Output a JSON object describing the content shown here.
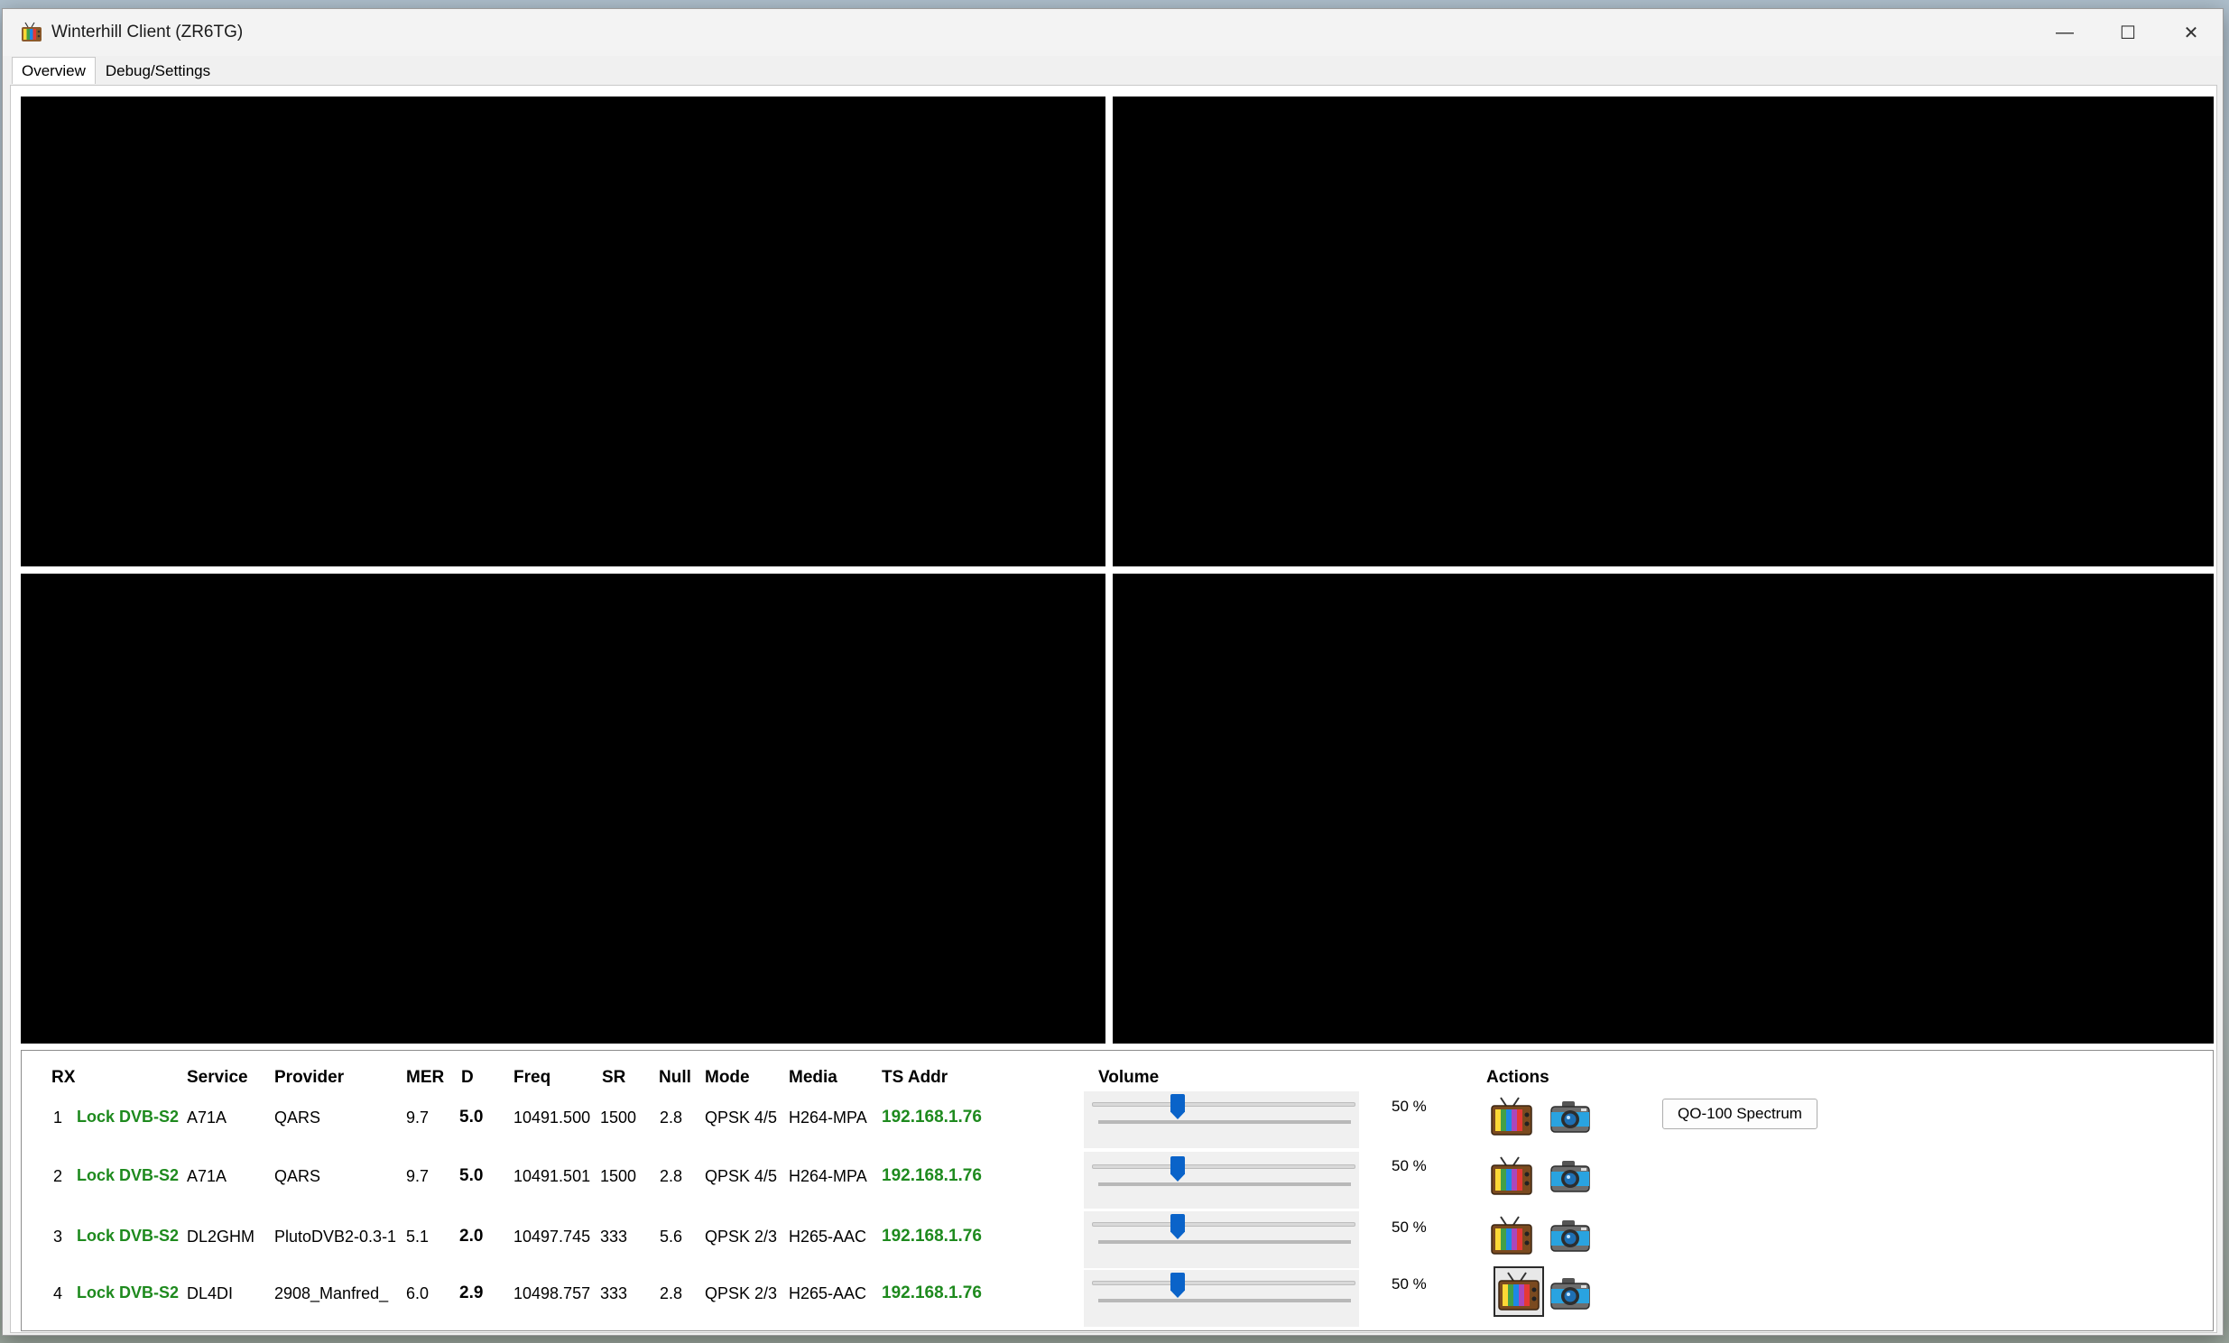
{
  "window": {
    "title": "Winterhill Client (ZR6TG)",
    "min_glyph": "—",
    "max_glyph": "☐",
    "close_glyph": "✕"
  },
  "tabs": [
    {
      "label": "Overview",
      "active": true
    },
    {
      "label": "Debug/Settings",
      "active": false
    }
  ],
  "table": {
    "headers": {
      "rx": "RX",
      "service": "Service",
      "provider": "Provider",
      "mer": "MER",
      "d": "D",
      "freq": "Freq",
      "sr": "SR",
      "null": "Null",
      "mode": "Mode",
      "media": "Media",
      "ts_addr": "TS Addr",
      "volume": "Volume",
      "actions": "Actions"
    },
    "rows": [
      {
        "rx": "1",
        "status": "Lock DVB-S2",
        "service": "A71A",
        "provider": "QARS",
        "mer": "9.7",
        "d": "5.0",
        "freq": "10491.500",
        "sr": "1500",
        "null": "2.8",
        "mode": "QPSK 4/5",
        "media": "H264-MPA",
        "ts_addr": "192.168.1.76",
        "volume_percent": 50,
        "volume_label": "50 %"
      },
      {
        "rx": "2",
        "status": "Lock DVB-S2",
        "service": "A71A",
        "provider": "QARS",
        "mer": "9.7",
        "d": "5.0",
        "freq": "10491.501",
        "sr": "1500",
        "null": "2.8",
        "mode": "QPSK 4/5",
        "media": "H264-MPA",
        "ts_addr": "192.168.1.76",
        "volume_percent": 50,
        "volume_label": "50 %"
      },
      {
        "rx": "3",
        "status": "Lock DVB-S2",
        "service": "DL2GHM",
        "provider": "PlutoDVB2-0.3-1",
        "mer": "5.1",
        "d": "2.0",
        "freq": "10497.745",
        "sr": "333",
        "null": "5.6",
        "mode": "QPSK 2/3",
        "media": "H265-AAC",
        "ts_addr": "192.168.1.76",
        "volume_percent": 50,
        "volume_label": "50 %"
      },
      {
        "rx": "4",
        "status": "Lock DVB-S2",
        "service": "DL4DI",
        "provider": "2908_Manfred_",
        "mer": "6.0",
        "d": "2.9",
        "freq": "10498.757",
        "sr": "333",
        "null": "2.8",
        "mode": "QPSK 2/3",
        "media": "H265-AAC",
        "ts_addr": "192.168.1.76",
        "volume_percent": 50,
        "volume_label": "50 %"
      }
    ]
  },
  "actions": {
    "tv_icon": "tv-icon",
    "camera_icon": "camera-icon",
    "spectrum_button": "QO-100 Spectrum"
  },
  "colors": {
    "lock_green": "#1e8a1e",
    "slider_blue": "#0a63c9",
    "video_bg": "#000000"
  }
}
